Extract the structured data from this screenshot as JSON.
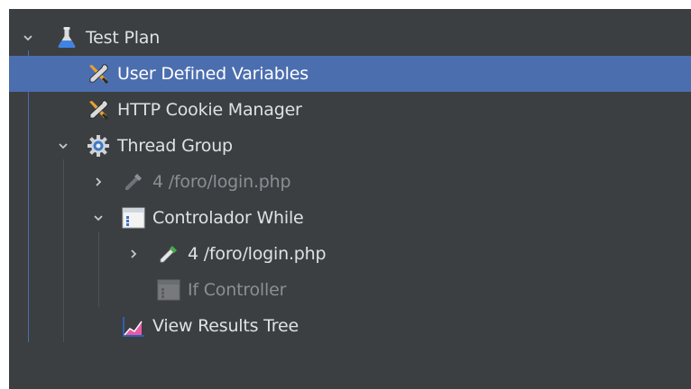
{
  "tree": {
    "items": [
      {
        "label": "Test Plan",
        "icon": "flask-icon",
        "expanded": true,
        "disabled": false
      },
      {
        "label": "User Defined Variables",
        "icon": "wrench-screwdriver-icon",
        "selected": true,
        "disabled": false
      },
      {
        "label": "HTTP Cookie Manager",
        "icon": "wrench-screwdriver-icon",
        "disabled": false
      },
      {
        "label": "Thread Group",
        "icon": "gear-icon",
        "expanded": true,
        "disabled": false
      },
      {
        "label": "4 /foro/login.php",
        "icon": "pipette-icon",
        "expanded": false,
        "disabled": true
      },
      {
        "label": "Controlador While",
        "icon": "logic-controller-icon",
        "expanded": true,
        "disabled": false
      },
      {
        "label": "4 /foro/login.php",
        "icon": "pipette-icon",
        "expanded": false,
        "disabled": false
      },
      {
        "label": "If Controller",
        "icon": "logic-controller-icon",
        "disabled": true
      },
      {
        "label": "View Results Tree",
        "icon": "results-chart-icon",
        "disabled": false
      }
    ]
  },
  "colors": {
    "background": "#3c3f41",
    "selection": "#4b6eaf",
    "text": "#dfe1e5",
    "disabled_text": "#8b8f93"
  }
}
